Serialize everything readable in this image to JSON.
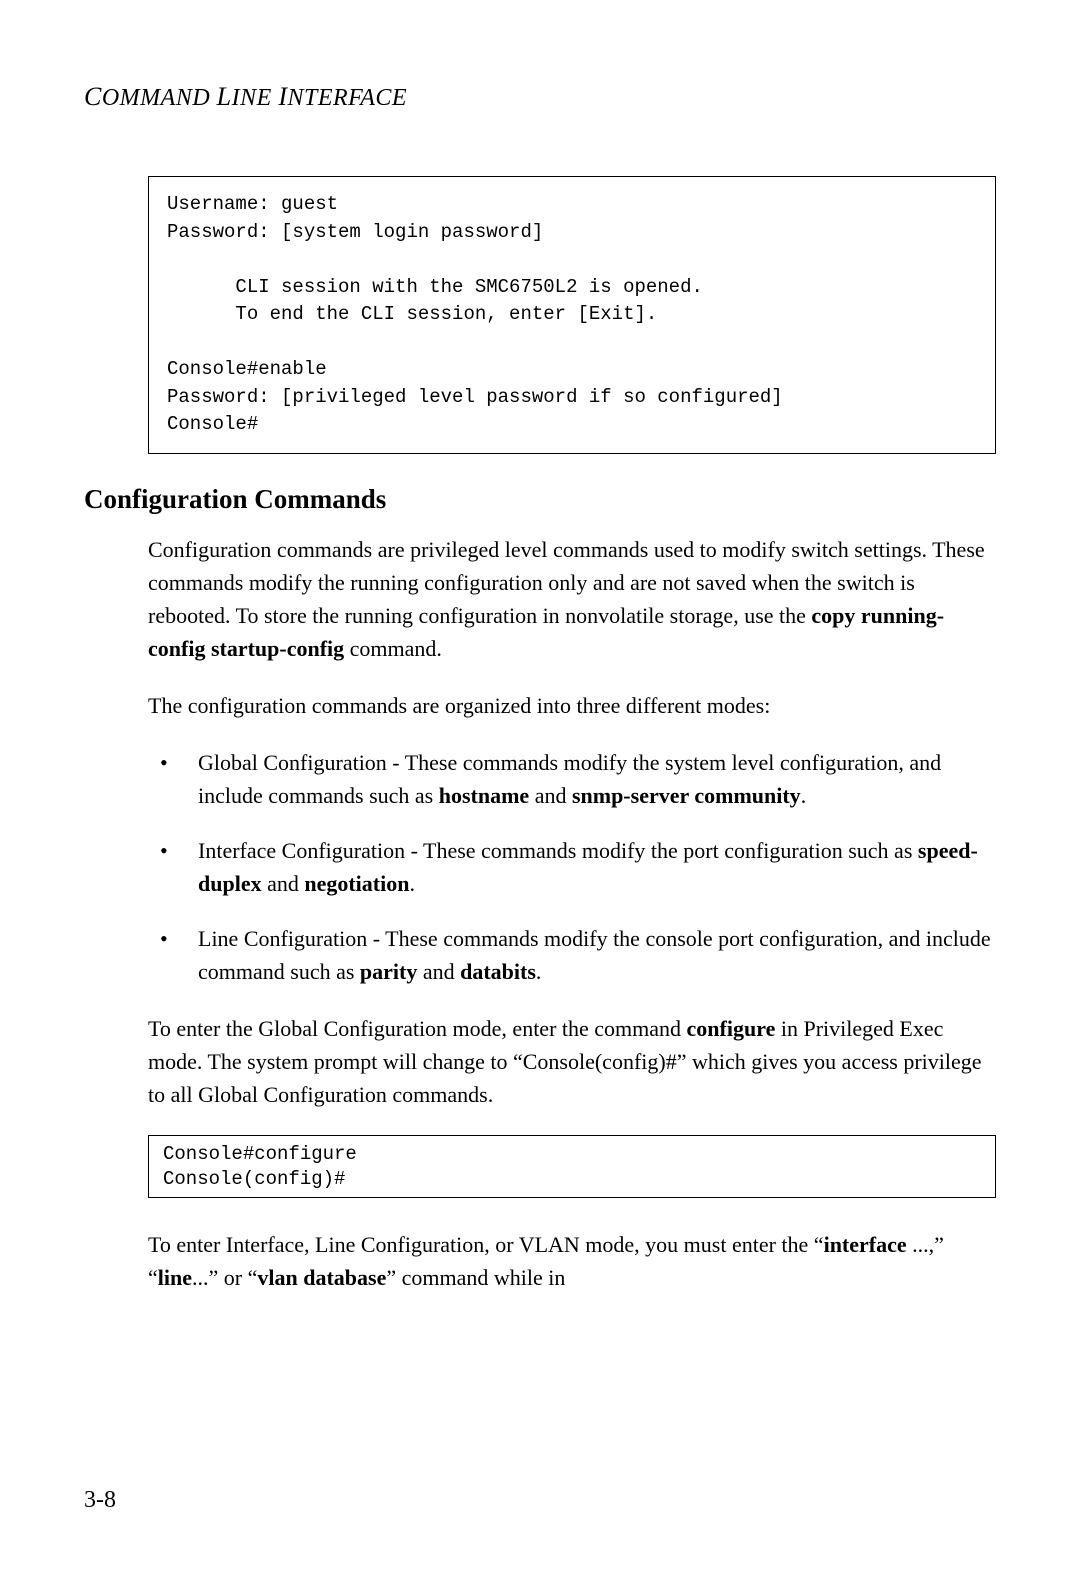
{
  "header": {
    "title_html": "<span class='cap'>C</span>OMMAND <span class='cap'>L</span>INE <span class='cap'>I</span>NTERFACE"
  },
  "code_block_1": "Username: guest\nPassword: [system login password]\n\n      CLI session with the SMC6750L2 is opened.\n      To end the CLI session, enter [Exit].\n\nConsole#enable\nPassword: [privileged level password if so configured]\nConsole#",
  "section_heading": "Configuration Commands",
  "para1_parts": {
    "t1": "Configuration commands are privileged level commands used to modify switch settings. These commands modify the running configuration only and are not saved when the switch is rebooted. To store the running configuration in nonvolatile storage, use the ",
    "b1": "copy running-config startup-config",
    "t2": " command."
  },
  "para2": "The configuration commands are organized into three different modes:",
  "bullets": [
    {
      "t1": "Global Configuration - These commands modify the system level configuration, and include commands such as ",
      "b1": "hostname",
      "t2": " and ",
      "b2": "snmp-server community",
      "t3": "."
    },
    {
      "t1": "Interface Configuration - These commands modify the port configuration such as ",
      "b1": "speed-duplex",
      "t2": " and ",
      "b2": "negotiation",
      "t3": "."
    },
    {
      "t1": "Line Configuration - These commands modify the console port configuration, and include command such as ",
      "b1": "parity",
      "t2": " and ",
      "b2": "databits",
      "t3": "."
    }
  ],
  "para3_parts": {
    "t1": "To enter the Global Configuration mode, enter the command ",
    "b1": "configure",
    "t2": " in Privileged Exec mode. The system prompt will change to “Console(config)#” which gives you access privilege to all Global Configuration commands."
  },
  "code_block_2": "Console#configure\nConsole(config)#",
  "para4_parts": {
    "t1": "To enter Interface, Line Configuration, or VLAN mode, you must enter the “",
    "b1": "interface",
    "t2": " ...,” “",
    "b2": "line",
    "t3": "...” or “",
    "b3": "vlan database",
    "t4": "” command while in"
  },
  "page_number": "3-8"
}
